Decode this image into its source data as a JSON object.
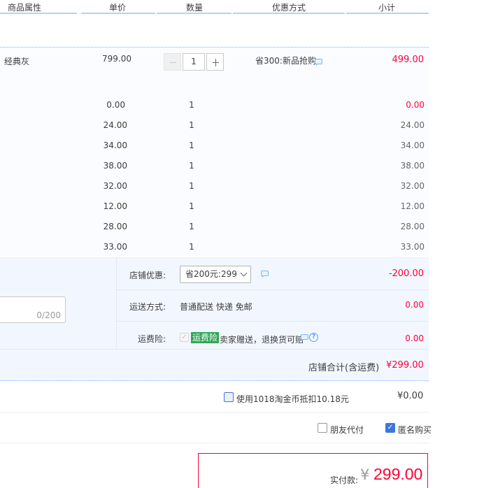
{
  "header": {
    "col_attr": "商品属性",
    "col_price": "单价",
    "col_qty": "数量",
    "col_discount": "优惠方式",
    "col_subtotal": "小计"
  },
  "item": {
    "attr": "经典灰",
    "price": "799.00",
    "qty": "1",
    "discount": "省300:新品抢购",
    "subtotal": "499.00"
  },
  "sub_items": [
    {
      "price": "0.00",
      "qty": "1",
      "subtotal": "0.00"
    },
    {
      "price": "24.00",
      "qty": "1",
      "subtotal": "24.00"
    },
    {
      "price": "34.00",
      "qty": "1",
      "subtotal": "34.00"
    },
    {
      "price": "38.00",
      "qty": "1",
      "subtotal": "38.00"
    },
    {
      "price": "32.00",
      "qty": "1",
      "subtotal": "32.00"
    },
    {
      "price": "12.00",
      "qty": "1",
      "subtotal": "12.00"
    },
    {
      "price": "28.00",
      "qty": "1",
      "subtotal": "28.00"
    },
    {
      "price": "33.00",
      "qty": "1",
      "subtotal": "33.00"
    }
  ],
  "shop": {
    "promo_label": "店铺优惠:",
    "promo_select": "省200元:299",
    "promo_amount": "-200.00",
    "shipping_label": "运送方式:",
    "shipping_value": "普通配送 快递 免邮",
    "shipping_amount": "0.00",
    "insurance_label": "运费险:",
    "insurance_badge": "运费险",
    "insurance_text": "卖家赠送，退换货可赔",
    "insurance_amount": "0.00",
    "memo_count": "0/200",
    "total_label": "店铺合计(含运费)",
    "total_amount": "¥299.00"
  },
  "coins": {
    "label": "使用1018淘金币抵扣10.18元",
    "amount": "¥0.00"
  },
  "options": {
    "friend_pay": "朋友代付",
    "anonymous": "匿名购买"
  },
  "pay": {
    "label": "实付款:",
    "yen": "¥",
    "amount": "299.00"
  },
  "colors": {
    "accent_red": "#ff0036",
    "accent_blue": "#3b78dd",
    "badge_green": "#31a656"
  }
}
